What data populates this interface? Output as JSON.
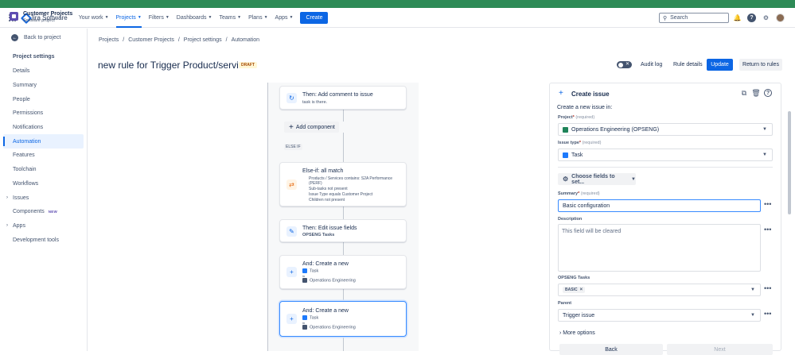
{
  "topnav": {
    "product": "Jira Software",
    "items": [
      "Your work",
      "Projects",
      "Filters",
      "Dashboards",
      "Teams",
      "Plans",
      "Apps"
    ],
    "create": "Create",
    "search_placeholder": "Search"
  },
  "sidebar": {
    "project_name": "Customer Projects",
    "project_type": "Software project",
    "back": "Back to project",
    "heading": "Project settings",
    "items": [
      {
        "label": "Details"
      },
      {
        "label": "Summary"
      },
      {
        "label": "People"
      },
      {
        "label": "Permissions"
      },
      {
        "label": "Notifications"
      },
      {
        "label": "Automation",
        "active": true
      },
      {
        "label": "Features"
      },
      {
        "label": "Toolchain"
      },
      {
        "label": "Workflows"
      },
      {
        "label": "Issues"
      },
      {
        "label": "Components",
        "badge": "NEW"
      },
      {
        "label": "Apps"
      },
      {
        "label": "Development tools"
      }
    ]
  },
  "breadcrumb": [
    "Projects",
    "Customer Projects",
    "Project settings",
    "Automation"
  ],
  "rule": {
    "title": "new rule for Trigger Product/services",
    "status": "DRAFT",
    "audit_log": "Audit log",
    "rule_details": "Rule details",
    "update": "Update",
    "return": "Return to rules"
  },
  "flow": {
    "comment_title": "Then: Add comment to issue",
    "comment_sub": "task is there.",
    "add_component": "Add component",
    "else_label": "ELSE IF",
    "elseif_title": "Else-if: all match",
    "elseif_conditions": [
      "Products / Services contains: S2A Performance",
      "(PERF)",
      "Sub-tasks not present",
      "Issue Type equals Customer Project",
      "Children not present"
    ],
    "edit_title": "Then: Edit issue fields",
    "edit_sub": "OPSENG Tasks",
    "create1_title": "And: Create a new",
    "create1_type": "Task",
    "create1_in": "in",
    "create1_project": "Operations Engineering",
    "create2_title": "And: Create a new",
    "create2_type": "Task",
    "create2_in": "in",
    "create2_project": "Operations Engineering"
  },
  "panel": {
    "title": "Create issue",
    "subtitle": "Create a new issue in:",
    "project_label": "Project",
    "required": "(required)",
    "project_value": "Operations Engineering (OPSENG)",
    "issuetype_label": "Issue type",
    "issuetype_value": "Task",
    "choose_fields": "Choose fields to set...",
    "summary_label": "Summary",
    "summary_value": "Basic configuration",
    "description_label": "Description",
    "description_placeholder": "This field will be cleared",
    "opseng_label": "OPSENG Tasks",
    "opseng_tag": "BASIC",
    "parent_label": "Parent",
    "parent_value": "Trigger issue",
    "more_options": "More options",
    "back": "Back",
    "next": "Next"
  }
}
